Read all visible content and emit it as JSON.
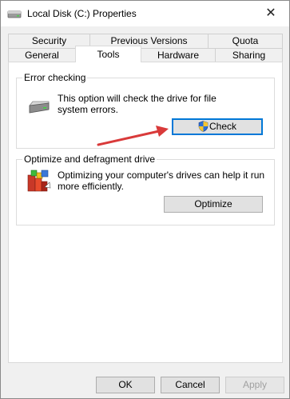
{
  "window": {
    "title": "Local Disk (C:) Properties",
    "close_glyph": "✕"
  },
  "tabs": {
    "row_top": [
      "Security",
      "Previous Versions",
      "Quota"
    ],
    "row_bottom": [
      "General",
      "Tools",
      "Hardware",
      "Sharing"
    ],
    "active": "Tools"
  },
  "error_checking": {
    "legend": "Error checking",
    "description_line1": "This option will check the drive for file",
    "description_line2": "system errors.",
    "check_label": "Check",
    "icon": "drive-icon",
    "button_icon": "uac-shield-icon"
  },
  "optimize": {
    "legend": "Optimize and defragment drive",
    "description_line1": "Optimizing your computer's drives can help it run",
    "description_line2": "more efficiently.",
    "optimize_label": "Optimize",
    "icon": "defrag-icon"
  },
  "footer": {
    "ok_label": "OK",
    "cancel_label": "Cancel",
    "apply_label": "Apply"
  },
  "annotation": {
    "color": "#d93a3a"
  }
}
